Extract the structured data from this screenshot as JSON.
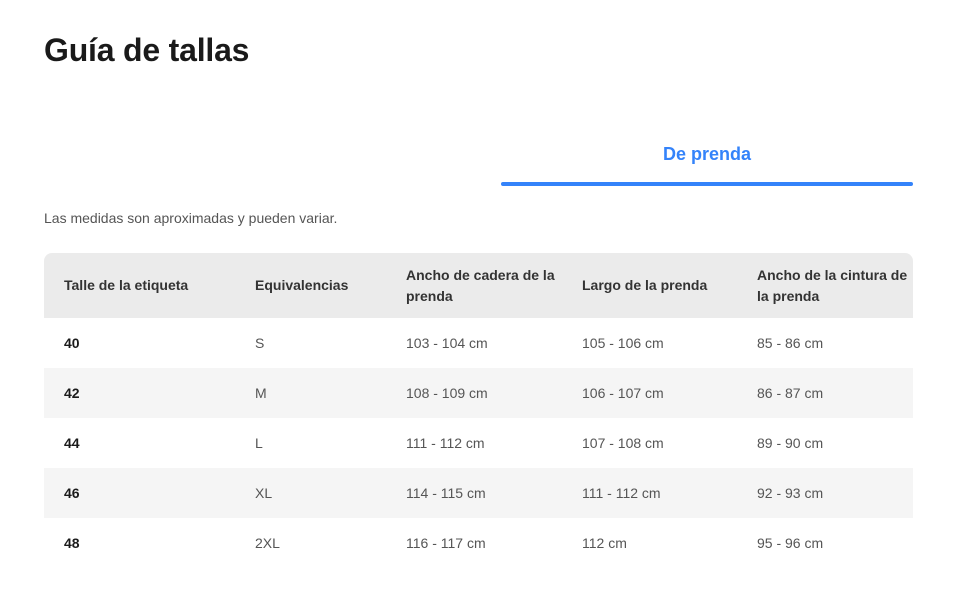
{
  "page": {
    "title": "Guía de tallas"
  },
  "tabs": [
    {
      "label": "De prenda",
      "active": true
    }
  ],
  "accent_color": "#3483fa",
  "disclaimer": "Las medidas son aproximadas y pueden variar.",
  "table": {
    "headers": [
      "Talle de la etiqueta",
      "Equivalencias",
      "Ancho de cadera de la prenda",
      "Largo de la prenda",
      "Ancho de la cintura de la prenda"
    ],
    "rows": [
      [
        "40",
        "S",
        "103 - 104 cm",
        "105 - 106 cm",
        "85 - 86 cm"
      ],
      [
        "42",
        "M",
        "108 - 109 cm",
        "106 - 107 cm",
        "86 - 87 cm"
      ],
      [
        "44",
        "L",
        "111 - 112 cm",
        "107 - 108 cm",
        "89 - 90 cm"
      ],
      [
        "46",
        "XL",
        "114 - 115 cm",
        "111 - 112 cm",
        "92 - 93 cm"
      ],
      [
        "48",
        "2XL",
        "116 - 117 cm",
        "112 cm",
        "95 - 96 cm"
      ]
    ]
  }
}
